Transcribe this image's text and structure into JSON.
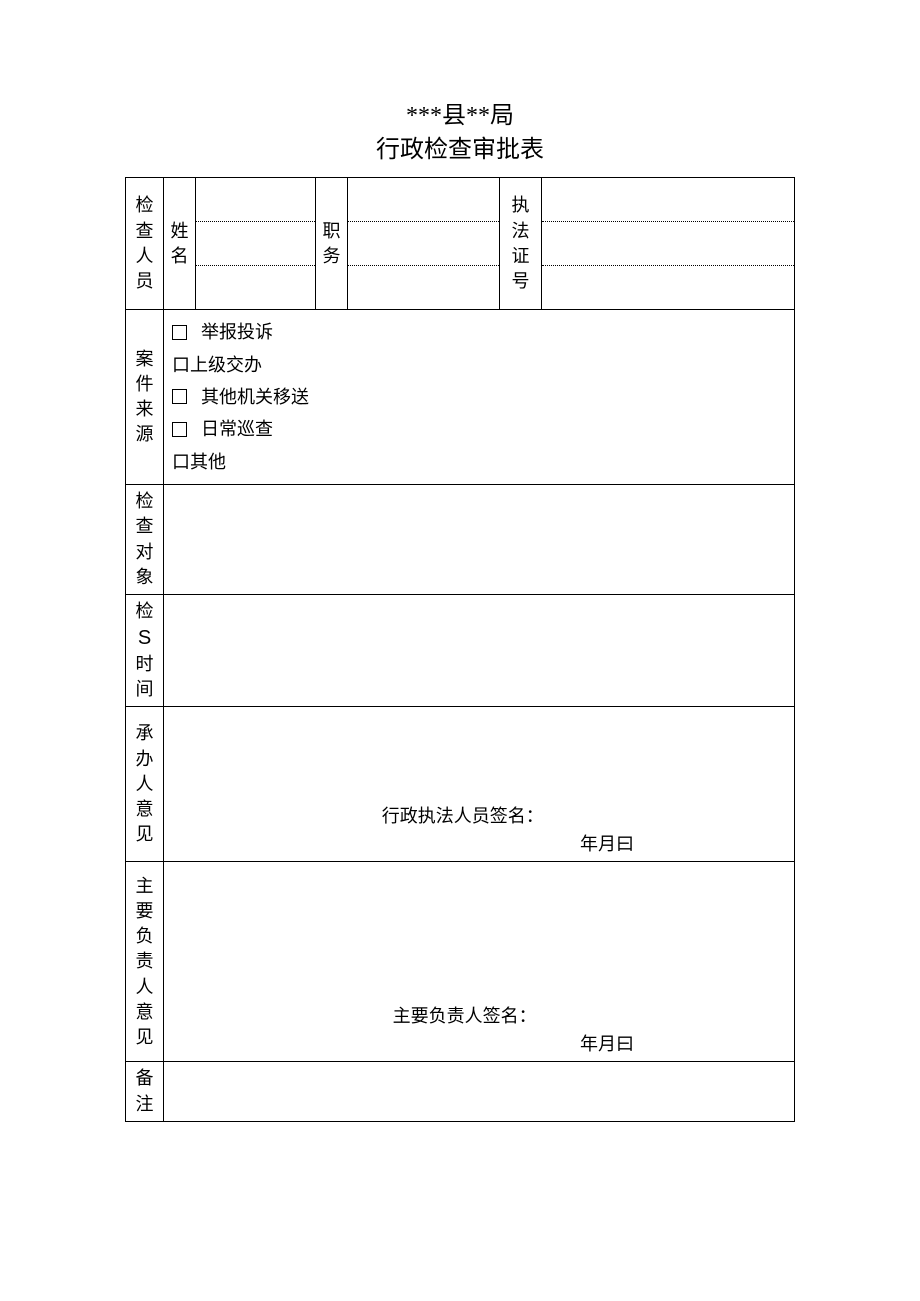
{
  "header": {
    "line1": "***县**局",
    "line2": "行政检查审批表"
  },
  "labels": {
    "inspector": "检查人员",
    "name": "姓名",
    "duty": "职务",
    "cert": "执法证号",
    "source": "案件来源",
    "target": "检查对象",
    "time_pre": "检",
    "time_s": "S",
    "time_post": "时间",
    "handler": "承办人意见",
    "principal": "主要负责人意见",
    "remarks": "备注"
  },
  "source_options": {
    "opt1": "举报投诉",
    "opt2": "口上级交办",
    "opt3": "其他机关移送",
    "opt4": "日常巡查",
    "opt5": "口其他"
  },
  "signatures": {
    "handler_sig": "行政执法人员签名：",
    "principal_sig": "主要负责人签名：",
    "date": "年月曰"
  }
}
